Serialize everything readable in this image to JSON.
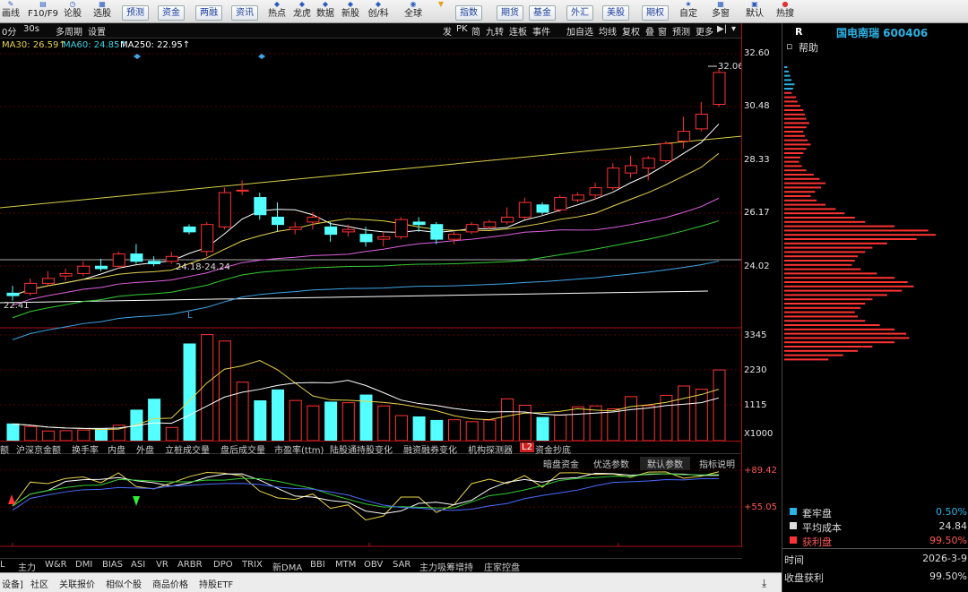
{
  "toolbar": {
    "left_items": [
      "画线",
      "F10/F9",
      "论股",
      "选股"
    ],
    "pill_a": [
      "预测",
      "资金",
      "两融",
      "资讯"
    ],
    "mid_items": [
      "热点",
      "龙虎",
      "数据",
      "新股",
      "创/科",
      "全球"
    ],
    "pill_b": [
      "指数",
      "期货",
      "基金",
      "外汇",
      "美股",
      "期权"
    ],
    "right_items": [
      "自定",
      "多窗",
      "默认",
      "热搜"
    ]
  },
  "subbar": {
    "left": [
      "0分",
      "30s",
      "多周期",
      "设置"
    ],
    "right": [
      "发",
      "PK",
      "简",
      "九转",
      "连板",
      "事件",
      "加自选",
      "均线",
      "复权",
      "叠",
      "窗",
      "预测",
      "更多"
    ]
  },
  "ma_legend": [
    {
      "text": "MA30: 26.59↑",
      "color": "#e8d44d"
    },
    {
      "text": "MA60: 24.85↑",
      "color": "#3fd3e6"
    },
    {
      "text": "MA250: 22.95↑",
      "color": "#ffffff"
    }
  ],
  "price_axis": [
    "32.60",
    "30.48",
    "28.33",
    "26.17",
    "24.02"
  ],
  "volume_axis": [
    "3345",
    "2230",
    "1115",
    "X1000"
  ],
  "indicator_axis": [
    "+89.42",
    "+55.05"
  ],
  "chart_labels": {
    "high_mark": "32.06",
    "low_mark": "22.41",
    "range_label": "24.18-24.24",
    "l_marker": "L"
  },
  "date_axis": [
    "01",
    "02",
    "03"
  ],
  "tabs_row1": [
    "额",
    "沪深京金额",
    "换手率",
    "内盘",
    "外盘",
    "立桩成交量",
    "盘后成交量",
    "市盈率(ttm)",
    "陆股通持股变化",
    "融资融券变化",
    "机构探测器",
    "L2",
    "资金抄底"
  ],
  "tabs_row2": [
    "暗盘资金",
    "优选参数",
    "默认参数",
    "指标说明"
  ],
  "tabs_row3": [
    "L",
    "主力",
    "W&R",
    "DMI",
    "BIAS",
    "ASI",
    "VR",
    "ARBR",
    "DPO",
    "TRIX",
    "新DMA",
    "BBI",
    "MTM",
    "OBV",
    "SAR",
    "主力吸筹增持",
    "庄家控盘"
  ],
  "bottom_tabs": [
    "设备]",
    "社区",
    "关联报价",
    "相似个股",
    "商品价格",
    "持股ETF"
  ],
  "right_panel": {
    "code_letter": "R",
    "stock_name": "国电南瑞 600406",
    "help_label": "帮助",
    "legend": [
      {
        "label": "套牢盘",
        "value": "0.50%",
        "color": "#2ab3e6"
      },
      {
        "label": "平均成本",
        "value": "24.84",
        "color": "#dddddd"
      },
      {
        "label": "获利盘",
        "value": "99.50%",
        "color": "#ff3333"
      }
    ],
    "time_label": "时间",
    "time_value": "2026-3-9",
    "profit_label": "收盘获利",
    "profit_value": "99.50%"
  },
  "chart_data": {
    "type": "candlestick",
    "ylim": [
      22.0,
      32.7
    ],
    "candles": [
      [
        22.9,
        23.2,
        22.6,
        22.8
      ],
      [
        22.9,
        23.5,
        22.8,
        23.3
      ],
      [
        23.3,
        23.8,
        23.2,
        23.5
      ],
      [
        23.6,
        23.9,
        23.4,
        23.7
      ],
      [
        23.7,
        24.2,
        23.6,
        24.0
      ],
      [
        24.0,
        24.3,
        23.8,
        23.9
      ],
      [
        24.0,
        24.6,
        23.9,
        24.5
      ],
      [
        24.5,
        24.9,
        24.1,
        24.2
      ],
      [
        24.2,
        24.4,
        24.0,
        24.1
      ],
      [
        24.2,
        24.6,
        24.1,
        24.4
      ],
      [
        25.6,
        25.7,
        25.3,
        25.4
      ],
      [
        24.6,
        25.8,
        24.4,
        25.7
      ],
      [
        25.6,
        27.2,
        25.5,
        27.0
      ],
      [
        27.1,
        27.5,
        26.9,
        27.1
      ],
      [
        26.8,
        27.0,
        25.9,
        26.1
      ],
      [
        26.0,
        26.6,
        25.4,
        25.7
      ],
      [
        25.5,
        25.8,
        25.3,
        25.6
      ],
      [
        25.8,
        26.2,
        25.5,
        26.0
      ],
      [
        25.6,
        25.8,
        25.0,
        25.3
      ],
      [
        25.4,
        25.7,
        25.2,
        25.5
      ],
      [
        25.3,
        25.6,
        24.8,
        25.0
      ],
      [
        25.1,
        25.4,
        24.8,
        25.2
      ],
      [
        25.2,
        26.0,
        25.1,
        25.9
      ],
      [
        25.8,
        26.0,
        25.4,
        25.7
      ],
      [
        25.7,
        25.8,
        24.9,
        25.1
      ],
      [
        25.1,
        25.4,
        24.9,
        25.3
      ],
      [
        25.4,
        25.8,
        25.3,
        25.7
      ],
      [
        25.6,
        25.9,
        25.5,
        25.8
      ],
      [
        25.8,
        26.4,
        25.7,
        26.0
      ],
      [
        26.0,
        26.8,
        25.9,
        26.6
      ],
      [
        26.5,
        26.6,
        26.1,
        26.2
      ],
      [
        26.3,
        26.9,
        26.2,
        26.8
      ],
      [
        26.7,
        27.0,
        26.6,
        26.9
      ],
      [
        26.9,
        27.4,
        26.7,
        27.2
      ],
      [
        27.2,
        28.2,
        27.1,
        28.0
      ],
      [
        27.8,
        28.5,
        27.6,
        28.1
      ],
      [
        28.0,
        28.5,
        27.5,
        28.4
      ],
      [
        28.3,
        29.1,
        28.2,
        29.0
      ],
      [
        29.1,
        30.1,
        28.8,
        29.5
      ],
      [
        29.6,
        30.7,
        29.5,
        30.2
      ],
      [
        30.6,
        32.06,
        30.5,
        31.9
      ]
    ],
    "volume": [
      520,
      440,
      300,
      310,
      330,
      370,
      480,
      950,
      1290,
      410,
      3010,
      3300,
      3100,
      1820,
      1240,
      1580,
      1250,
      1080,
      1200,
      1180,
      1420,
      1080,
      780,
      740,
      630,
      650,
      590,
      640,
      1300,
      1100,
      720,
      800,
      1050,
      1080,
      990,
      1370,
      1090,
      1410,
      1700,
      1600,
      2200
    ]
  }
}
